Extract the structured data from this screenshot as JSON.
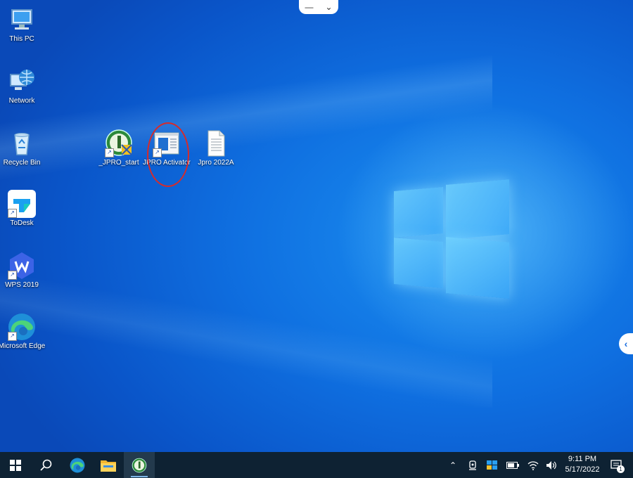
{
  "remote_bar": {
    "minimize_icon": "minus-icon",
    "expand_icon": "chevron-down-icon"
  },
  "desktop_icons": [
    {
      "label": "This PC",
      "icon": "computer-icon"
    },
    {
      "label": "Network",
      "icon": "network-globe-icon"
    },
    {
      "label": "Recycle Bin",
      "icon": "recycle-bin-icon"
    },
    {
      "label": "ToDesk",
      "icon": "todesk-icon"
    },
    {
      "label": "WPS 2019",
      "icon": "wps-icon"
    },
    {
      "label": "Microsoft Edge",
      "icon": "edge-icon"
    },
    {
      "label": "_JPRO_start",
      "icon": "jpro-start-icon"
    },
    {
      "label": "JPRO Activator",
      "icon": "jpro-activator-icon"
    },
    {
      "label": "Jpro 2022A",
      "icon": "text-file-icon"
    }
  ],
  "taskbar": {
    "items": [
      "start-icon",
      "search-icon",
      "edge-icon",
      "file-explorer-icon",
      "jpro-running-icon"
    ],
    "tray": [
      "chevron-up-icon",
      "meet-now-icon",
      "defender-icon",
      "battery-icon",
      "wifi-icon",
      "volume-icon"
    ],
    "clock": {
      "time": "9:11 PM",
      "date": "5/17/2022"
    },
    "notifications_count": "1"
  },
  "colors": {
    "accent": "#0a5fd6",
    "taskbar": "#0e2233",
    "highlight": "#d62b2b"
  }
}
